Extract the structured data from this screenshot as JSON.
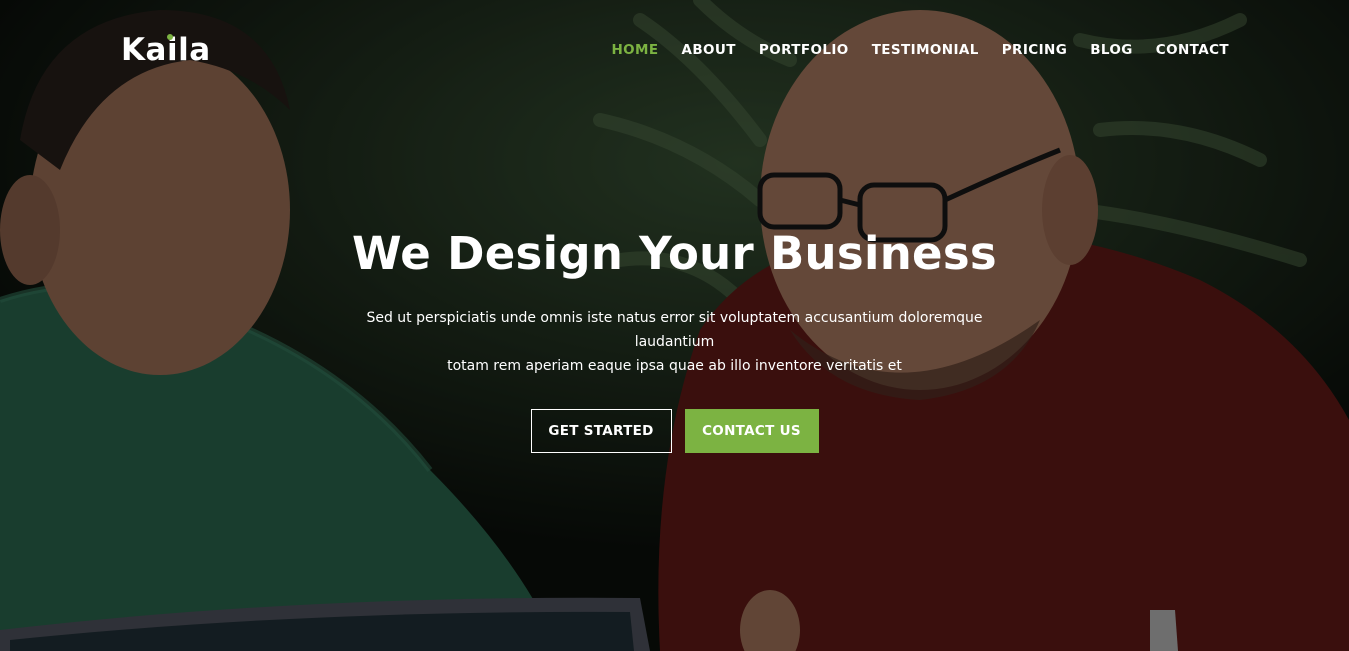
{
  "brand": {
    "name": "Kaila",
    "accent_color": "#7cb342"
  },
  "nav": {
    "items": [
      {
        "label": "HOME",
        "active": true
      },
      {
        "label": "ABOUT",
        "active": false
      },
      {
        "label": "PORTFOLIO",
        "active": false
      },
      {
        "label": "TESTIMONIAL",
        "active": false
      },
      {
        "label": "PRICING",
        "active": false
      },
      {
        "label": "BLOG",
        "active": false
      },
      {
        "label": "CONTACT",
        "active": false
      }
    ]
  },
  "hero": {
    "title": "We Design Your Business",
    "description_line1": "Sed ut perspiciatis unde omnis iste natus error sit voluptatem accusantium doloremque laudantium",
    "description_line2": "totam rem aperiam eaque ipsa quae ab illo inventore veritatis et",
    "primary_button": "GET STARTED",
    "secondary_button": "CONTACT US"
  }
}
